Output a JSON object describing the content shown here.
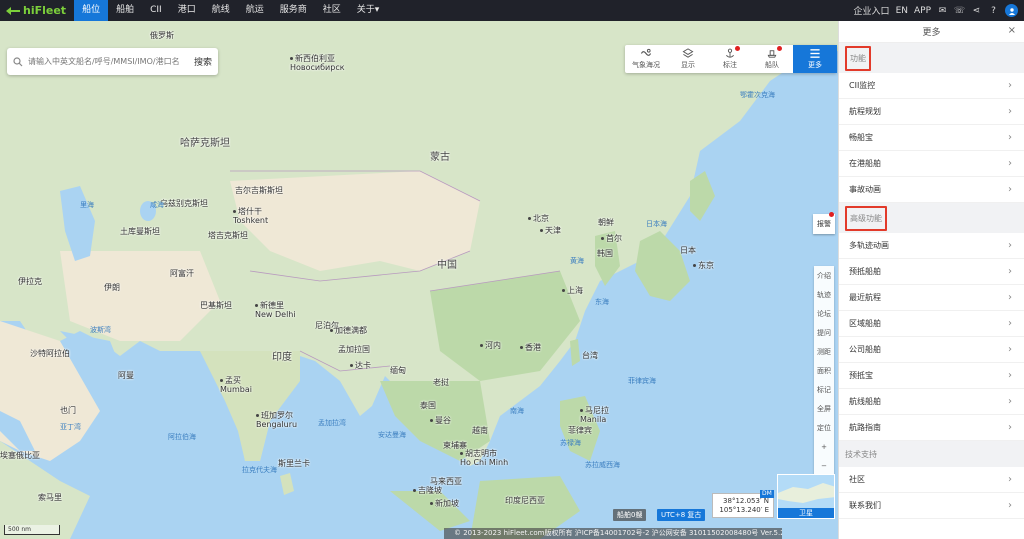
{
  "topnav": {
    "logo": "hiFleet",
    "items": [
      "船位",
      "船舶",
      "CII",
      "港口",
      "航线",
      "航运",
      "服务商",
      "社区",
      "关于"
    ],
    "active_index": 0,
    "right": {
      "account": "企业入口",
      "lang": "EN",
      "app": "APP"
    }
  },
  "search": {
    "placeholder": "请输入中英文船名/呼号/MMSI/IMO/港口名",
    "button": "搜索"
  },
  "toolbar": [
    {
      "label": "气象海况",
      "icon": "weather-icon",
      "badge": false
    },
    {
      "label": "显示",
      "icon": "layers-icon",
      "badge": false
    },
    {
      "label": "标注",
      "icon": "anchor-pin-icon",
      "badge": true
    },
    {
      "label": "船队",
      "icon": "fleet-icon",
      "badge": true
    },
    {
      "label": "更多",
      "icon": "menu-icon",
      "badge": false
    }
  ],
  "map": {
    "labels": {
      "tianjin": "天津",
      "beijing": "北京",
      "shanghai": "上海",
      "seoul": "首尔",
      "tokyo": "东京",
      "china": "中国",
      "mongolia": "蒙古",
      "kazakhstan": "哈萨克斯坦",
      "india": "印度",
      "iran": "伊朗",
      "afghanistan": "阿富汗",
      "pakistan": "巴基斯坦",
      "turkmenistan": "土库曼斯坦",
      "uzbekistan": "乌兹别克斯坦",
      "kyrgyzstan": "吉尔吉斯斯坦",
      "tajikistan": "塔吉克斯坦",
      "iraq": "伊拉克",
      "saudi": "沙特阿拉伯",
      "yemen": "也门",
      "oman": "阿曼",
      "nepal": "尼泊尔",
      "bangladesh": "孟加拉国",
      "myanmar": "缅甸",
      "thailand": "泰国",
      "laos": "老挝",
      "vietnam": "越南",
      "cambodia": "柬埔寨",
      "philippines": "菲律宾",
      "malaysia": "马来西亚",
      "indonesia": "印度尼西亚",
      "japan": "日本",
      "korea": "韩国",
      "north_korea": "朝鲜",
      "sri_lanka": "斯里兰卡",
      "somalia": "索马里",
      "ethiopia": "埃塞俄比亚",
      "taiwan": "台湾",
      "hongkong": "香港",
      "mumbai": "孟买\nMumbai",
      "bengaluru": "班加罗尔\nBengaluru",
      "delhi": "新德里\nNew Delhi",
      "kathmandu": "加德满都",
      "dhaka": "达卡",
      "bangkok": "曼谷",
      "hanoi": "河内",
      "hcm": "胡志明市\nHo Chi Minh",
      "manila": "马尼拉\nManila",
      "novosibirsk": "新西伯利亚\nНовосибирск",
      "tashkent": "塔什干\nToshkent",
      "caspian": "里海",
      "aral": "咸海",
      "persian_gulf": "波斯湾",
      "arabian_sea": "阿拉伯海",
      "bay_of_bengal": "孟加拉湾",
      "andaman": "安达曼海",
      "south_china_sea": "南海",
      "east_china_sea": "东海",
      "yellow_sea": "黄海",
      "sea_of_japan": "日本海",
      "okhotsk": "鄂霍次克海",
      "philippine_sea": "菲律宾海",
      "laccadive": "拉克代夫海",
      "arabian_gulf": "亚丁湾",
      "sulu": "苏禄海",
      "celebes": "苏拉威西海",
      "kuala_lumpur": "吉隆坡",
      "singapore": "新加坡",
      "russia": "俄罗斯"
    }
  },
  "report_button": "报警",
  "controls": [
    "介绍",
    "轨迹",
    "论坛",
    "提问",
    "测距",
    "面积",
    "标记",
    "全屏",
    "定位",
    "+",
    "−"
  ],
  "ship_count": "船舶0艘",
  "utc": "UTC+8 复古",
  "coords": {
    "lat": "38°12.053′ N",
    "lon": "105°13.240′ E"
  },
  "minimap": {
    "dm": "DM",
    "satellite": "卫星"
  },
  "scale": "500 nm",
  "footer": "© 2013-2023 hiFleet.com版权所有 沪ICP备14001702号-2 沪公网安备 31011502008480号   Ver.5.2.581",
  "panel": {
    "title": "更多",
    "sections": [
      {
        "label": "功能",
        "highlighted": true,
        "items": [
          "CII监控",
          "航程规划",
          "畅船宝",
          "在港船舶",
          "事故动画"
        ]
      },
      {
        "label": "高级功能",
        "highlighted": true,
        "items": [
          "多轨迹动画",
          "预抵船舶",
          "最近航程",
          "区域船舶",
          "公司船舶",
          "预抵宝",
          "航线船舶",
          "航路指南"
        ]
      },
      {
        "label": "技术支持",
        "highlighted": false,
        "items": [
          "社区",
          "联系我们"
        ]
      }
    ]
  }
}
